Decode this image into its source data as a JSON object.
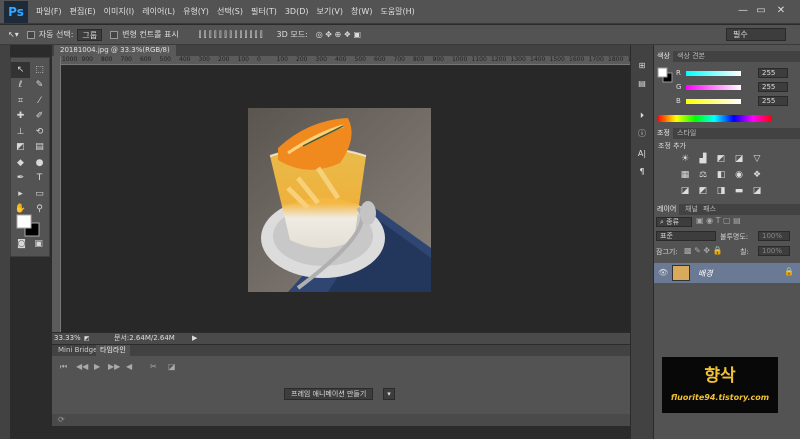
{
  "app": {
    "logo": "Ps"
  },
  "menu": [
    "파일(F)",
    "편집(E)",
    "이미지(I)",
    "레이어(L)",
    "유형(Y)",
    "선택(S)",
    "필터(T)",
    "3D(D)",
    "보기(V)",
    "창(W)",
    "도움말(H)"
  ],
  "window_controls": {
    "minimize": "—",
    "restore": "▭",
    "close": "✕"
  },
  "options": {
    "auto_select_label": "자동 선택:",
    "auto_select_value": "그룹",
    "transform_label": "변형 컨트롤 표시",
    "mode_3d_label": "3D 모드:",
    "workspace": "필수"
  },
  "document": {
    "tab_title": "20181004.jpg @ 33.3%(RGB/8)",
    "ruler_ticks": [
      "1000",
      "900",
      "800",
      "700",
      "600",
      "500",
      "400",
      "300",
      "200",
      "100",
      "0",
      "100",
      "200",
      "300",
      "400",
      "500",
      "600",
      "700",
      "800",
      "900",
      "1000",
      "1100",
      "1200",
      "1300",
      "1400",
      "1500",
      "1600",
      "1700",
      "1800",
      "19"
    ]
  },
  "status": {
    "zoom": "33.33%",
    "doc_info": "문서:2.64M/2.64M"
  },
  "timeline": {
    "tabs": [
      "Mini Bridge",
      "타임라인"
    ],
    "create_button": "프레임 애니메이션 만들기"
  },
  "color_panel": {
    "tabs": [
      "색상",
      "색상 견본"
    ],
    "channels": [
      {
        "name": "R",
        "value": "255"
      },
      {
        "name": "G",
        "value": "255"
      },
      {
        "name": "B",
        "value": "255"
      }
    ]
  },
  "adjustments_panel": {
    "tabs": [
      "조정",
      "스타일"
    ],
    "title": "조정 추가"
  },
  "layers_panel": {
    "tabs": [
      "레이어",
      "채널",
      "패스"
    ],
    "filter_kind": "종류",
    "blend_mode": "표준",
    "opacity_label": "불투명도:",
    "opacity_value": "100%",
    "lock_label": "잠그기:",
    "fill_label": "칠:",
    "fill_value": "100%",
    "layer_name": "배경"
  },
  "watermark": {
    "title": "향삭",
    "url": "fluorite94.tistory.com"
  },
  "colors": {
    "accent": "#31a8ff",
    "panel": "#535353",
    "canvas": "#282828",
    "selected_layer": "#6a7a95",
    "watermark_text": "#f1c232"
  }
}
